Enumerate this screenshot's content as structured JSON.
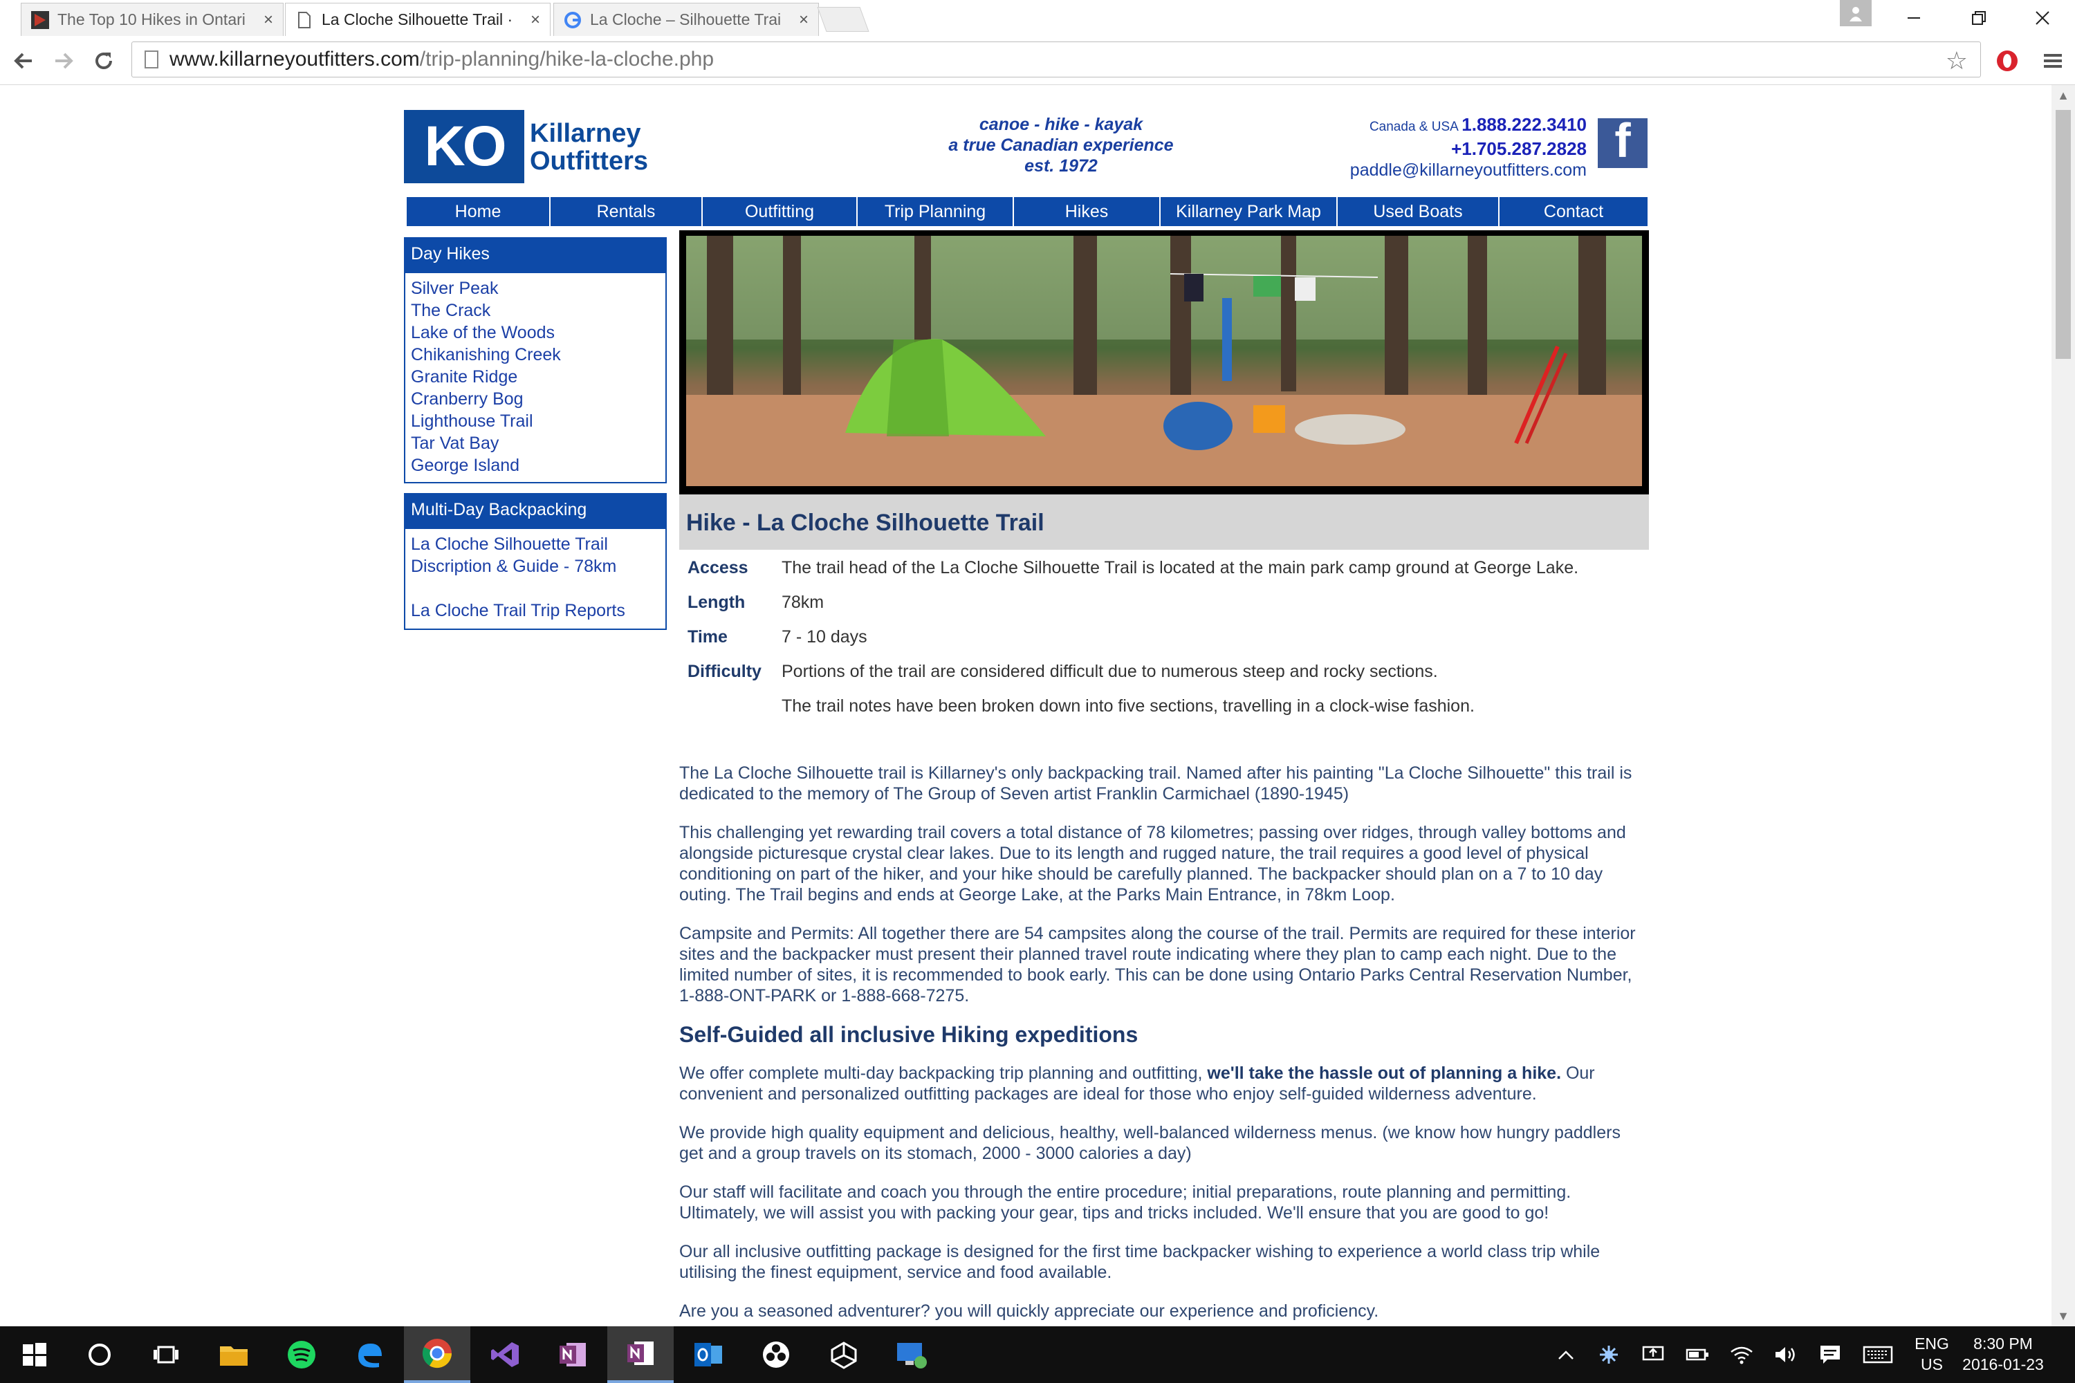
{
  "browser": {
    "tabs": [
      {
        "title": "The Top 10 Hikes in Ontari",
        "close": "×",
        "active": false
      },
      {
        "title": "La Cloche Silhouette Trail ·",
        "close": "×",
        "active": true
      },
      {
        "title": "La Cloche – Silhouette Trai",
        "close": "×",
        "active": false
      }
    ],
    "url_host": "www.killarneyoutfitters.com",
    "url_path": "/trip-planning/hike-la-cloche.php"
  },
  "site": {
    "logo_mark": "KO",
    "logo_name_line1": "Killarney",
    "logo_name_line2": "Outfitters",
    "tagline": [
      "canoe - hike - kayak",
      "a true Canadian experience",
      "est. 1972"
    ],
    "contact_prefix": "Canada & USA",
    "phone1": "1.888.222.3410",
    "phone2": "+1.705.287.2828",
    "email": "paddle@killarneyoutfitters.com",
    "facebook_glyph": "f",
    "nav": [
      "Home",
      "Rentals",
      "Outfitting",
      "Trip Planning",
      "Hikes",
      "Killarney Park Map",
      "Used Boats",
      "Contact"
    ]
  },
  "sidebar": {
    "day_hikes_title": "Day Hikes",
    "day_hikes": [
      "Silver Peak",
      "The Crack",
      "Lake of the Woods",
      "Chikanishing Creek",
      "Granite Ridge",
      "Cranberry Bog",
      "Lighthouse Trail",
      "Tar Vat Bay",
      "George Island"
    ],
    "multi_day_title": "Multi-Day Backpacking",
    "multi_day": [
      "La Cloche Silhouette Trail",
      "Discription & Guide - 78km",
      "La Cloche Trail Trip Reports"
    ]
  },
  "main": {
    "title": "Hike - La Cloche Silhouette Trail",
    "facts": [
      {
        "label": "Access",
        "value": "The trail head of the La Cloche Silhouette Trail is located at the main park camp ground at George Lake."
      },
      {
        "label": "Length",
        "value": "78km"
      },
      {
        "label": "Time",
        "value": "7 - 10 days"
      },
      {
        "label": "Difficulty",
        "value": "Portions of the trail are considered difficult due to numerous steep and rocky sections."
      },
      {
        "label": "",
        "value": "The trail notes have been broken down into five sections, travelling in a clock-wise fashion."
      }
    ],
    "p1": "The La Cloche Silhouette trail is Killarney's only backpacking trail. Named after his painting \"La Cloche Silhouette\" this trail is dedicated to the memory of The Group of Seven artist Franklin Carmichael (1890-1945)",
    "p2": "This challenging yet rewarding trail covers a total distance of 78 kilometres; passing over ridges, through valley bottoms and alongside picturesque crystal clear lakes. Due to its length and rugged nature, the trail requires a good level of physical conditioning on part of the hiker, and your hike should be carefully planned. The backpacker should plan on a 7 to 10 day outing. The Trail begins and ends at George Lake, at the Parks Main Entrance, in 78km Loop.",
    "p3": "Campsite and Permits: All together there are 54 campsites along the course of the trail. Permits are required for these interior sites and the backpacker must present their planned travel route indicating where they plan to camp each night. Due to the limited number of sites, it is recommended to book early. This can be done using Ontario Parks Central Reservation Number, 1-888-ONT-PARK or 1-888-668-7275.",
    "h2": "Self-Guided all inclusive Hiking expeditions",
    "p4_pre": "We offer complete multi-day backpacking trip planning and outfitting, ",
    "p4_bold": "we'll take the hassle out of planning a hike.",
    "p4_post": " Our convenient and personalized outfitting packages are ideal for those who enjoy self-guided wilderness adventure.",
    "p5": "We provide high quality equipment and delicious, healthy, well-balanced wilderness menus. (we know how hungry paddlers get and a group travels on its stomach, 2000 - 3000 calories a day)",
    "p6": "Our staff will facilitate and coach you through the entire procedure; initial preparations, route planning and permitting. Ultimately, we will assist you with packing your gear, tips and tricks included. We'll ensure that you are good to go!",
    "p7": "Our all inclusive outfitting package is designed for the first time backpacker wishing to experience a world class trip while utilising the finest equipment, service and food available.",
    "p8": "Are you a seasoned adventurer? you will quickly appreciate our experience and proficiency."
  },
  "taskbar": {
    "lang1": "ENG",
    "lang2": "US",
    "time": "8:30 PM",
    "date": "2016-01-23"
  }
}
